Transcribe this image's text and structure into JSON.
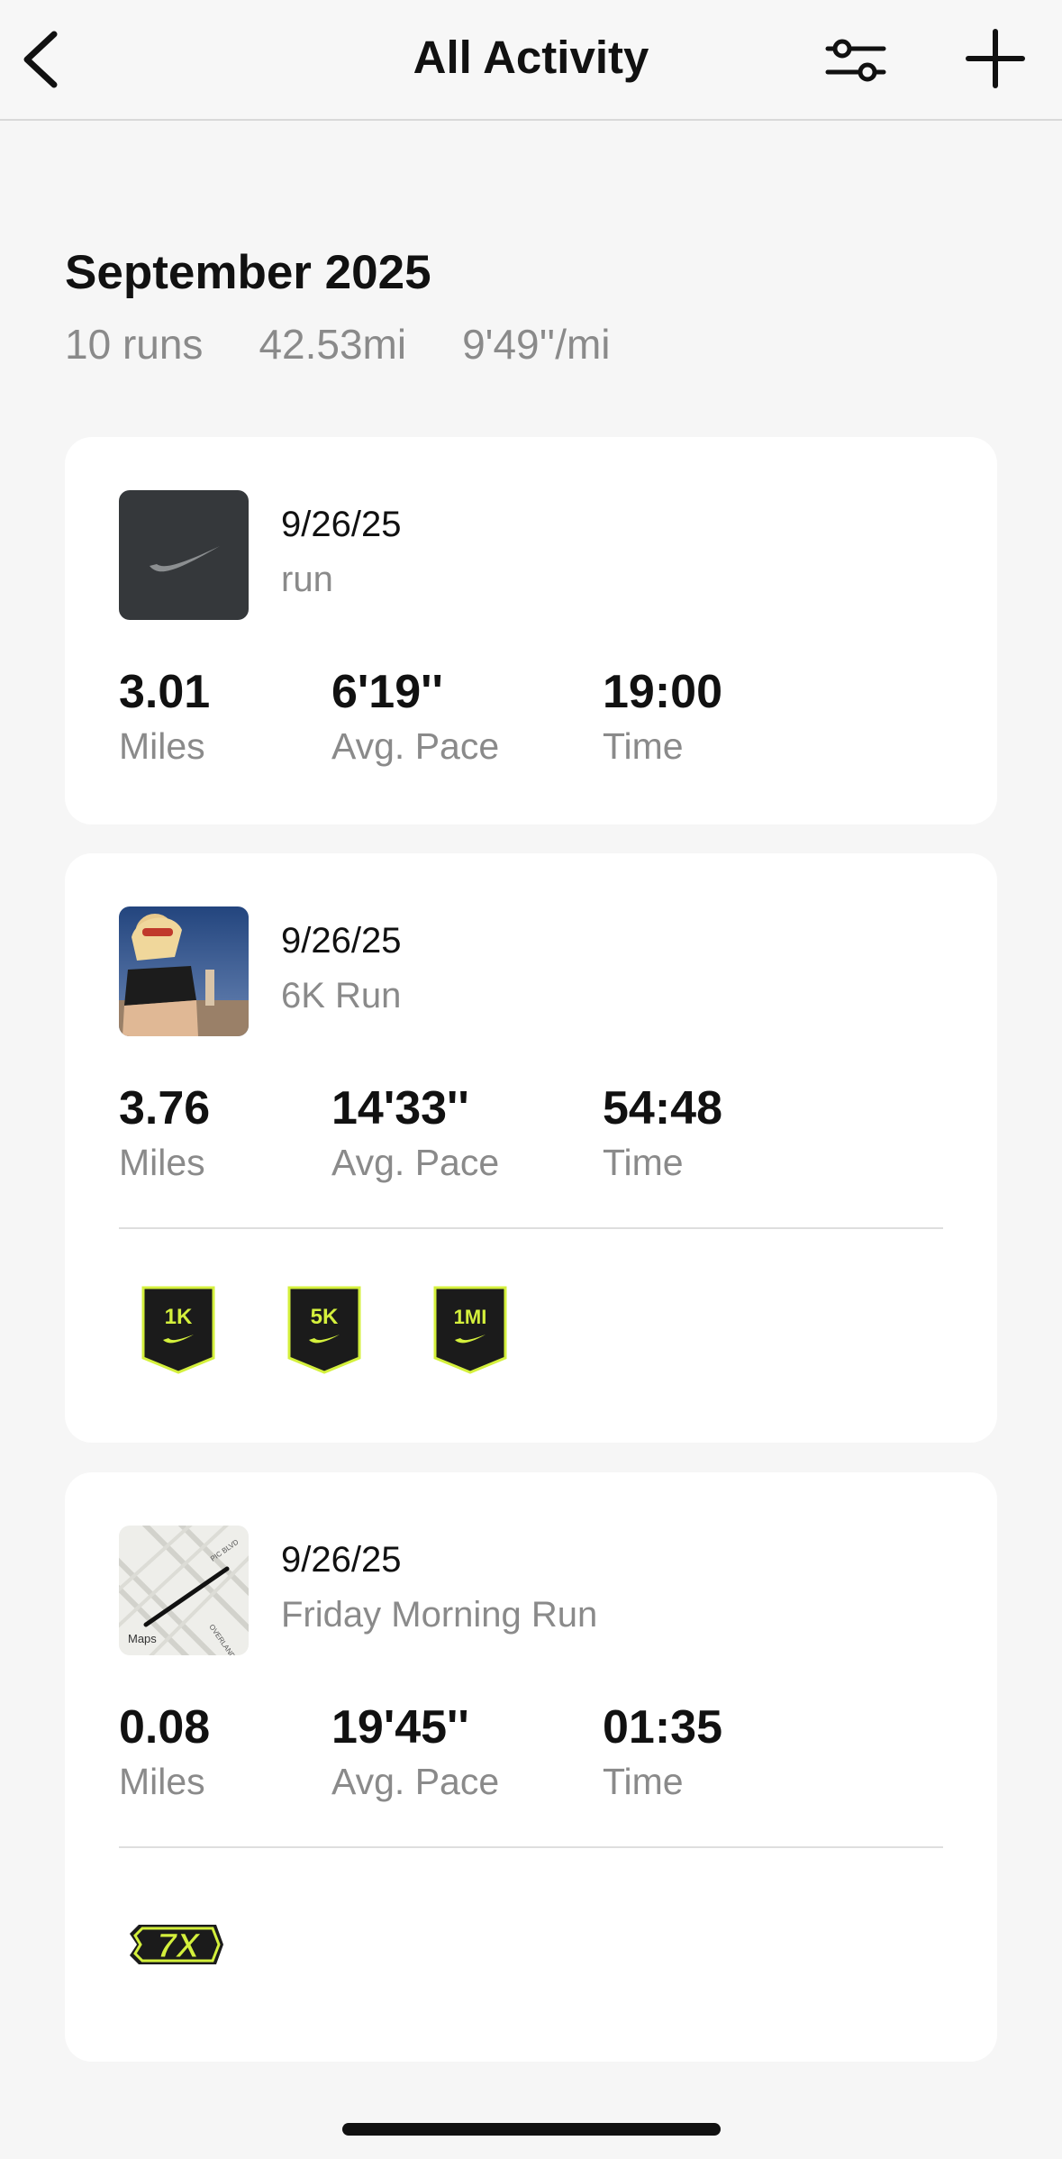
{
  "header": {
    "title": "All Activity",
    "icons": [
      "back-chevron-icon",
      "filter-sliders-icon",
      "plus-icon"
    ]
  },
  "month": {
    "title": "September 2025",
    "runs": "10 runs",
    "distance": "42.53mi",
    "pace": "9'49''/mi"
  },
  "activities": [
    {
      "date": "9/26/25",
      "name": "run",
      "thumbnail": "nike-swoosh-icon",
      "stats": [
        {
          "value": "3.01",
          "label": "Miles"
        },
        {
          "value": "6'19''",
          "label": "Avg. Pace"
        },
        {
          "value": "19:00",
          "label": "Time"
        }
      ]
    },
    {
      "date": "9/26/25",
      "name": "6K Run",
      "thumbnail": "runner-photo",
      "stats": [
        {
          "value": "3.76",
          "label": "Miles"
        },
        {
          "value": "14'33''",
          "label": "Avg. Pace"
        },
        {
          "value": "54:48",
          "label": "Time"
        }
      ],
      "badges": [
        "1K",
        "5K",
        "1MI"
      ]
    },
    {
      "date": "9/26/25",
      "name": "Friday Morning Run",
      "thumbnail": "route-map",
      "map_label": "Maps",
      "stats": [
        {
          "value": "0.08",
          "label": "Miles"
        },
        {
          "value": "19'45''",
          "label": "Avg. Pace"
        },
        {
          "value": "01:35",
          "label": "Time"
        }
      ],
      "badges": [
        "7X"
      ]
    }
  ],
  "colors": {
    "badge_accent": "#d4f03c",
    "badge_dark": "#1b1b1b",
    "muted_text": "#8a8a8a"
  }
}
